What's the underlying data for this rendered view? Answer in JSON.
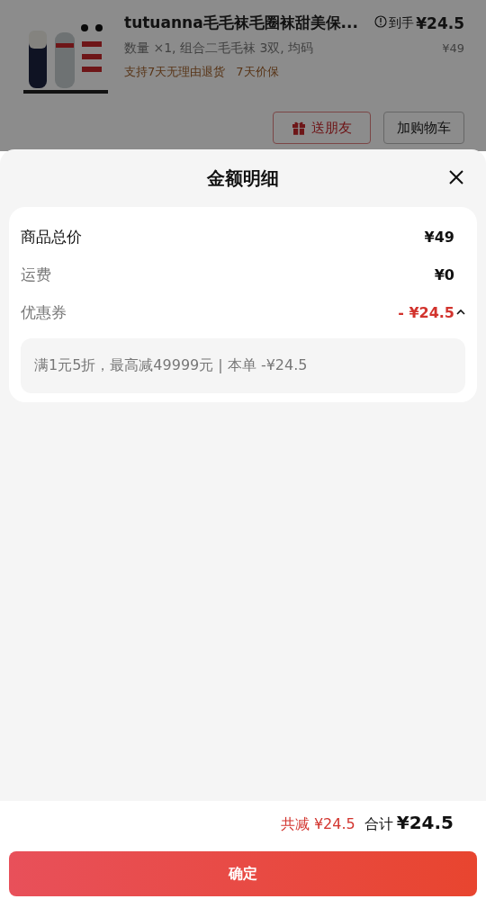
{
  "product": {
    "kind": "picture",
    "title": "tutuanna毛毛袜毛圈袜甜美保...",
    "price_label": "到手",
    "price": "¥24.5",
    "spec": "数量 ×1, 组合二毛毛袜 3双, 均码",
    "original_price": "¥49",
    "services": [
      "支持7天无理由退货",
      "7天价保"
    ],
    "buttons": [
      {
        "kind": "gift",
        "label": "送朋友"
      },
      {
        "kind": "plain",
        "label": "加购物车"
      }
    ]
  },
  "sheet": {
    "title": "金额明细",
    "rows": [
      {
        "kind": "total",
        "label": "商品总价",
        "value": "¥49"
      },
      {
        "kind": "plain",
        "label": "运费",
        "value": "¥0"
      },
      {
        "kind": "discount",
        "label": "优惠券",
        "value": "- ¥24.5",
        "expanded": true,
        "detail": "满1元5折，最高减49999元 | 本单 -¥24.5"
      }
    ]
  },
  "footer": {
    "saved": "共减 ¥24.5",
    "total_label": "合计",
    "total": "¥24.5",
    "confirm": "确定"
  }
}
